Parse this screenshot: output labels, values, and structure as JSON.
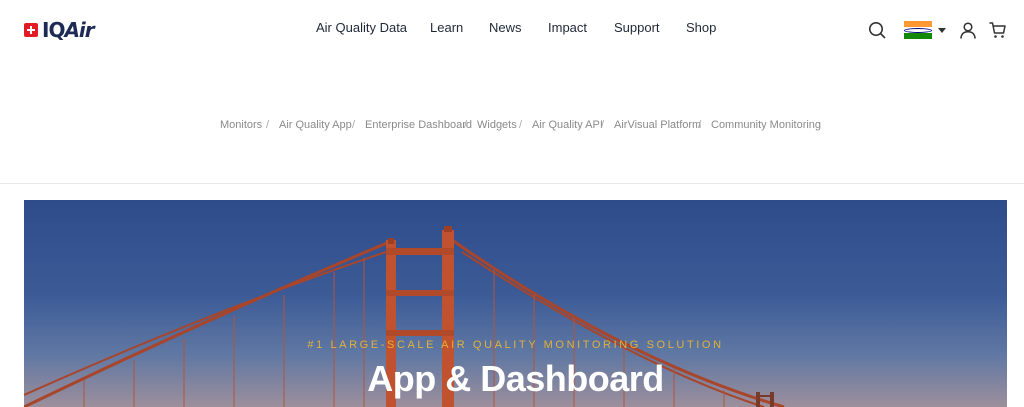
{
  "header": {
    "logo_text_iq": "IQ",
    "logo_text_air": "Air",
    "nav": [
      "Air Quality Data",
      "Learn",
      "News",
      "Impact",
      "Support",
      "Shop"
    ],
    "icons": {
      "search": "search-icon",
      "country_flag": "india-flag-icon",
      "account": "user-icon",
      "cart": "cart-icon"
    }
  },
  "subnav": {
    "items": [
      "Monitors",
      "Air Quality App",
      "Enterprise Dashboard",
      "Widgets",
      "Air Quality API",
      "AirVisual Platform",
      "Community Monitoring"
    ],
    "separator": "/"
  },
  "hero": {
    "eyebrow": "#1 LARGE-SCALE AIR QUALITY MONITORING SOLUTION",
    "title": "App & Dashboard"
  },
  "colors": {
    "brand_red": "#e21c23",
    "brand_navy": "#1c2a55",
    "eyebrow_gold": "#e0b23a",
    "bridge_orange": "#c0522f"
  }
}
